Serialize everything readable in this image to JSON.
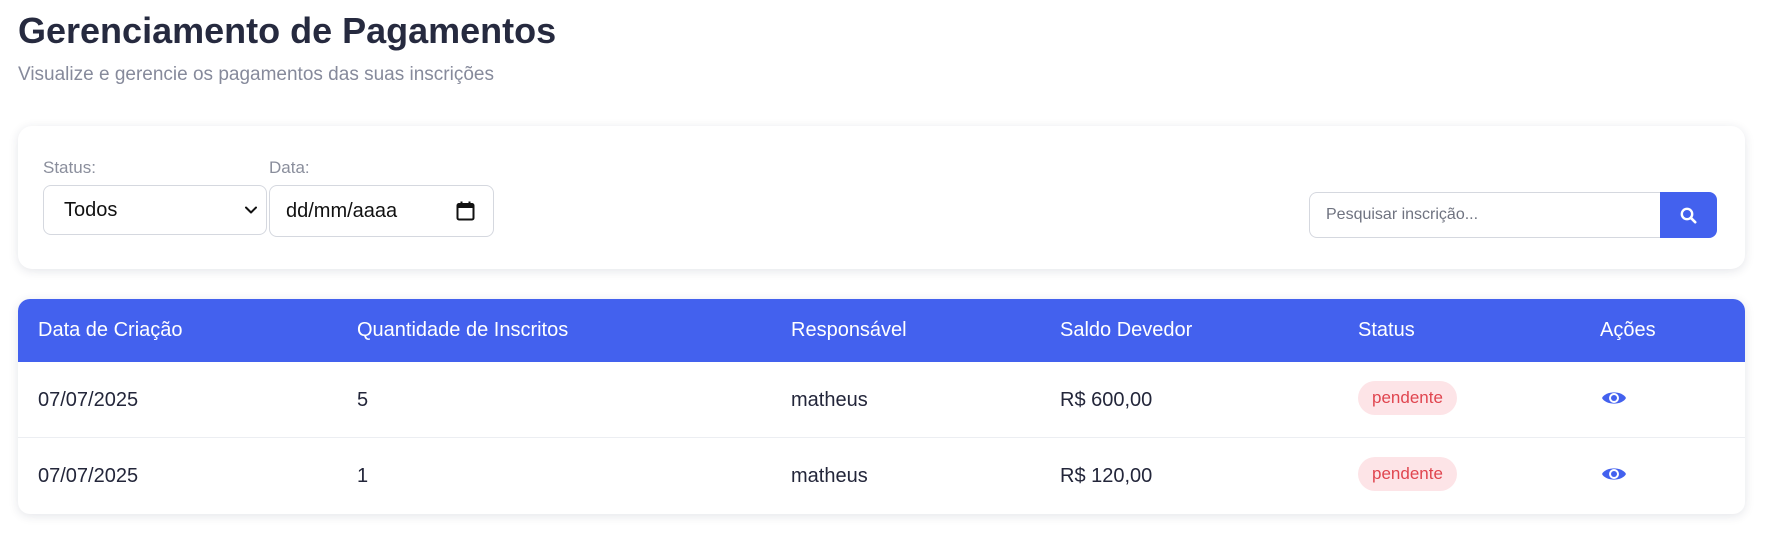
{
  "header": {
    "title": "Gerenciamento de Pagamentos",
    "subtitle": "Visualize e gerencie os pagamentos das suas inscrições"
  },
  "filters": {
    "status_label": "Status:",
    "status_value": "Todos",
    "date_label": "Data:",
    "date_value": "dd/mm/aaaa",
    "search_placeholder": "Pesquisar inscrição..."
  },
  "table": {
    "columns": [
      "Data de Criação",
      "Quantidade de Inscritos",
      "Responsável",
      "Saldo Devedor",
      "Status",
      "Ações"
    ],
    "rows": [
      {
        "date": "07/07/2025",
        "quantity": "5",
        "responsible": "matheus",
        "balance": "R$ 600,00",
        "status": "pendente"
      },
      {
        "date": "07/07/2025",
        "quantity": "1",
        "responsible": "matheus",
        "balance": "R$ 120,00",
        "status": "pendente"
      }
    ]
  },
  "colors": {
    "accent": "#4361ee",
    "status_pending_bg": "#fde4e7",
    "status_pending_text": "#e0454f"
  },
  "icons": {
    "status_select": "chevron-down-icon",
    "date_picker": "calendar-icon",
    "search": "search-icon",
    "view": "eye-icon"
  }
}
